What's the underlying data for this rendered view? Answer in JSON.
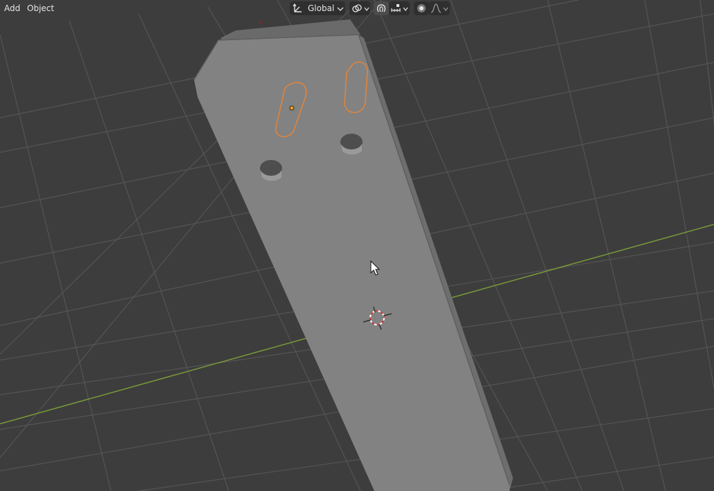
{
  "header": {
    "menu": [
      {
        "label": "Add"
      },
      {
        "label": "Object"
      }
    ],
    "transform_orientation": {
      "value": "Global",
      "icon": "orientation-icon"
    },
    "pivot_icon": "pivot-point-icon",
    "snap_icon": "snap-magnet-icon",
    "snap_target_icon": "snap-increment-icon",
    "proportional_icon": "proportional-editing-icon",
    "falloff_icon": "falloff-curve-icon"
  },
  "scene": {
    "colors": {
      "background": "#3d3d3d",
      "grid": "#555555",
      "x_axis": "#7a9a3a",
      "mesh": "#828282",
      "mesh_edge": "#5e5e5e",
      "selection_outline": "#e0843c",
      "origin": "#e89b2e",
      "cursor_ring": "#cf3a3a"
    }
  }
}
